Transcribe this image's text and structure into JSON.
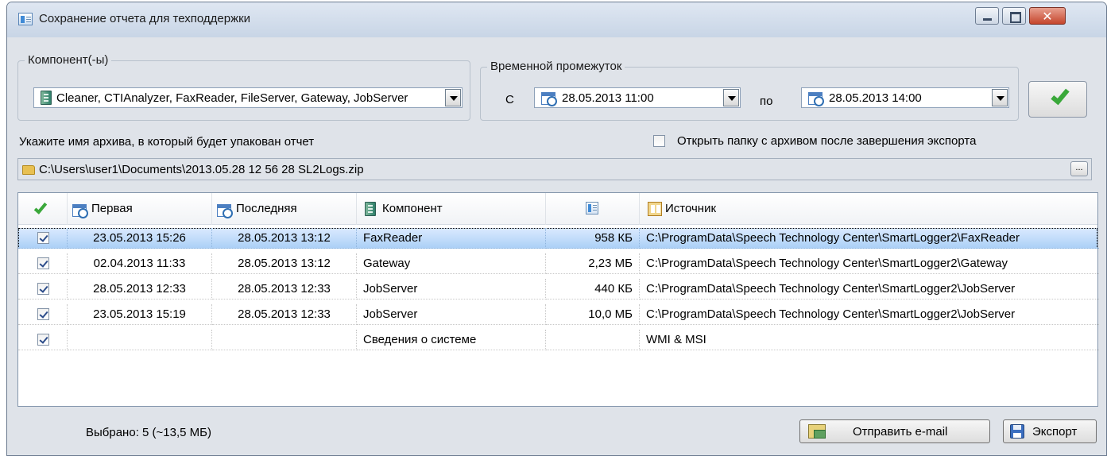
{
  "window": {
    "title": "Сохранение отчета для техподдержки",
    "icon": "report-window-icon"
  },
  "components_group": {
    "legend": "Компонент(-ы)",
    "selected_value": "Cleaner, CTIAnalyzer, FaxReader, FileServer, Gateway, JobServer"
  },
  "time_group": {
    "legend": "Временной промежуток",
    "from_label": "С",
    "from_value": "28.05.2013 11:00",
    "to_label": "по",
    "to_value": "28.05.2013 14:00"
  },
  "archive": {
    "label": "Укажите имя архива, в который будет упакован отчет",
    "open_folder_label": "Открыть папку с архивом после завершения экспорта",
    "open_folder_checked": false,
    "path": "C:\\Users\\user1\\Documents\\2013.05.28 12 56 28 SL2Logs.zip",
    "browse_label": "..."
  },
  "table": {
    "columns": [
      "",
      "Первая",
      "Последняя",
      "Компонент",
      "",
      "Источник"
    ],
    "rows": [
      {
        "checked": true,
        "first": "23.05.2013 15:26",
        "last": "28.05.2013 13:12",
        "component": "FaxReader",
        "size": "958 КБ",
        "source": "C:\\ProgramData\\Speech Technology Center\\SmartLogger2\\FaxReader",
        "selected": true
      },
      {
        "checked": true,
        "first": "02.04.2013 11:33",
        "last": "28.05.2013 13:12",
        "component": "Gateway",
        "size": "2,23 МБ",
        "source": "C:\\ProgramData\\Speech Technology Center\\SmartLogger2\\Gateway",
        "selected": false
      },
      {
        "checked": true,
        "first": "28.05.2013 12:33",
        "last": "28.05.2013 12:33",
        "component": "JobServer",
        "size": "440 КБ",
        "source": "C:\\ProgramData\\Speech Technology Center\\SmartLogger2\\JobServer",
        "selected": false
      },
      {
        "checked": true,
        "first": "23.05.2013 15:19",
        "last": "28.05.2013 12:33",
        "component": "JobServer",
        "size": "10,0 МБ",
        "source": "C:\\ProgramData\\Speech Technology Center\\SmartLogger2\\JobServer",
        "selected": false
      },
      {
        "checked": true,
        "first": "",
        "last": "",
        "component": "Сведения о системе",
        "size": "",
        "source": "WMI & MSI",
        "selected": false
      }
    ]
  },
  "status": {
    "selected_text": "Выбрано:  5 (~13,5 МБ)"
  },
  "buttons": {
    "email_label": "Отправить e-mail",
    "export_label": "Экспорт"
  },
  "colors": {
    "window_bg": "#dfe3e9",
    "selection": "#aacff6",
    "accent_check": "#3aa83a"
  }
}
